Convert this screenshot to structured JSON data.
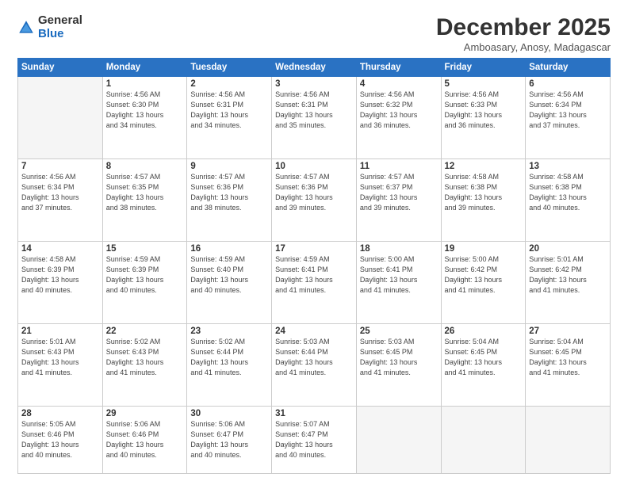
{
  "logo": {
    "general": "General",
    "blue": "Blue"
  },
  "header": {
    "month": "December 2025",
    "location": "Amboasary, Anosy, Madagascar"
  },
  "weekdays": [
    "Sunday",
    "Monday",
    "Tuesday",
    "Wednesday",
    "Thursday",
    "Friday",
    "Saturday"
  ],
  "weeks": [
    [
      {
        "day": "",
        "info": ""
      },
      {
        "day": "1",
        "info": "Sunrise: 4:56 AM\nSunset: 6:30 PM\nDaylight: 13 hours\nand 34 minutes."
      },
      {
        "day": "2",
        "info": "Sunrise: 4:56 AM\nSunset: 6:31 PM\nDaylight: 13 hours\nand 34 minutes."
      },
      {
        "day": "3",
        "info": "Sunrise: 4:56 AM\nSunset: 6:31 PM\nDaylight: 13 hours\nand 35 minutes."
      },
      {
        "day": "4",
        "info": "Sunrise: 4:56 AM\nSunset: 6:32 PM\nDaylight: 13 hours\nand 36 minutes."
      },
      {
        "day": "5",
        "info": "Sunrise: 4:56 AM\nSunset: 6:33 PM\nDaylight: 13 hours\nand 36 minutes."
      },
      {
        "day": "6",
        "info": "Sunrise: 4:56 AM\nSunset: 6:34 PM\nDaylight: 13 hours\nand 37 minutes."
      }
    ],
    [
      {
        "day": "7",
        "info": "Sunrise: 4:56 AM\nSunset: 6:34 PM\nDaylight: 13 hours\nand 37 minutes."
      },
      {
        "day": "8",
        "info": "Sunrise: 4:57 AM\nSunset: 6:35 PM\nDaylight: 13 hours\nand 38 minutes."
      },
      {
        "day": "9",
        "info": "Sunrise: 4:57 AM\nSunset: 6:36 PM\nDaylight: 13 hours\nand 38 minutes."
      },
      {
        "day": "10",
        "info": "Sunrise: 4:57 AM\nSunset: 6:36 PM\nDaylight: 13 hours\nand 39 minutes."
      },
      {
        "day": "11",
        "info": "Sunrise: 4:57 AM\nSunset: 6:37 PM\nDaylight: 13 hours\nand 39 minutes."
      },
      {
        "day": "12",
        "info": "Sunrise: 4:58 AM\nSunset: 6:38 PM\nDaylight: 13 hours\nand 39 minutes."
      },
      {
        "day": "13",
        "info": "Sunrise: 4:58 AM\nSunset: 6:38 PM\nDaylight: 13 hours\nand 40 minutes."
      }
    ],
    [
      {
        "day": "14",
        "info": "Sunrise: 4:58 AM\nSunset: 6:39 PM\nDaylight: 13 hours\nand 40 minutes."
      },
      {
        "day": "15",
        "info": "Sunrise: 4:59 AM\nSunset: 6:39 PM\nDaylight: 13 hours\nand 40 minutes."
      },
      {
        "day": "16",
        "info": "Sunrise: 4:59 AM\nSunset: 6:40 PM\nDaylight: 13 hours\nand 40 minutes."
      },
      {
        "day": "17",
        "info": "Sunrise: 4:59 AM\nSunset: 6:41 PM\nDaylight: 13 hours\nand 41 minutes."
      },
      {
        "day": "18",
        "info": "Sunrise: 5:00 AM\nSunset: 6:41 PM\nDaylight: 13 hours\nand 41 minutes."
      },
      {
        "day": "19",
        "info": "Sunrise: 5:00 AM\nSunset: 6:42 PM\nDaylight: 13 hours\nand 41 minutes."
      },
      {
        "day": "20",
        "info": "Sunrise: 5:01 AM\nSunset: 6:42 PM\nDaylight: 13 hours\nand 41 minutes."
      }
    ],
    [
      {
        "day": "21",
        "info": "Sunrise: 5:01 AM\nSunset: 6:43 PM\nDaylight: 13 hours\nand 41 minutes."
      },
      {
        "day": "22",
        "info": "Sunrise: 5:02 AM\nSunset: 6:43 PM\nDaylight: 13 hours\nand 41 minutes."
      },
      {
        "day": "23",
        "info": "Sunrise: 5:02 AM\nSunset: 6:44 PM\nDaylight: 13 hours\nand 41 minutes."
      },
      {
        "day": "24",
        "info": "Sunrise: 5:03 AM\nSunset: 6:44 PM\nDaylight: 13 hours\nand 41 minutes."
      },
      {
        "day": "25",
        "info": "Sunrise: 5:03 AM\nSunset: 6:45 PM\nDaylight: 13 hours\nand 41 minutes."
      },
      {
        "day": "26",
        "info": "Sunrise: 5:04 AM\nSunset: 6:45 PM\nDaylight: 13 hours\nand 41 minutes."
      },
      {
        "day": "27",
        "info": "Sunrise: 5:04 AM\nSunset: 6:45 PM\nDaylight: 13 hours\nand 41 minutes."
      }
    ],
    [
      {
        "day": "28",
        "info": "Sunrise: 5:05 AM\nSunset: 6:46 PM\nDaylight: 13 hours\nand 40 minutes."
      },
      {
        "day": "29",
        "info": "Sunrise: 5:06 AM\nSunset: 6:46 PM\nDaylight: 13 hours\nand 40 minutes."
      },
      {
        "day": "30",
        "info": "Sunrise: 5:06 AM\nSunset: 6:47 PM\nDaylight: 13 hours\nand 40 minutes."
      },
      {
        "day": "31",
        "info": "Sunrise: 5:07 AM\nSunset: 6:47 PM\nDaylight: 13 hours\nand 40 minutes."
      },
      {
        "day": "",
        "info": ""
      },
      {
        "day": "",
        "info": ""
      },
      {
        "day": "",
        "info": ""
      }
    ]
  ]
}
